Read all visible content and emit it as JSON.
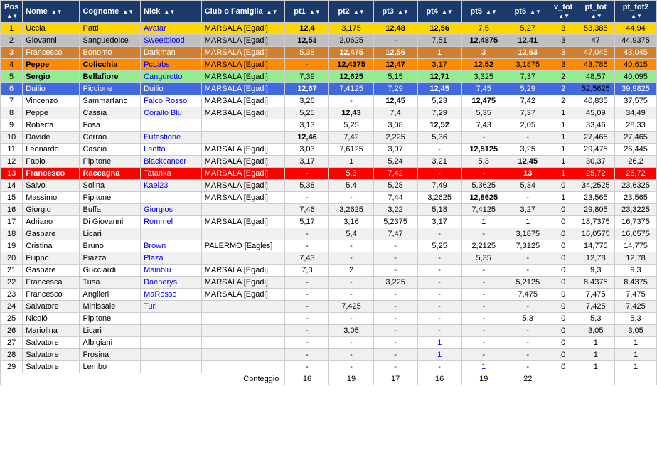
{
  "header": {
    "pos": "Pos",
    "nome": "Nome",
    "cognome": "Cognome",
    "nick": "Nick",
    "club": "Club o Famiglia",
    "pt1": "pt1",
    "pt2": "pt2",
    "pt3": "pt3",
    "pt4": "pt4",
    "pt5": "pt5",
    "pt6": "pt6",
    "v_tot": "v_tot",
    "pt_tot": "pt_tot",
    "pt_tot2": "pt_tot2"
  },
  "rows": [
    {
      "pos": "1",
      "nome": "Uccia",
      "cognome": "Patti",
      "nick": "Avatar",
      "club": "MARSALA [Egadi]",
      "pt1": "12,4",
      "pt2": "3,175",
      "pt3": "12,48",
      "pt4": "12,56",
      "pt5": "7,5",
      "pt6": "5,27",
      "v_tot": "3",
      "pt_tot": "53,385",
      "pt_tot2": "44,94",
      "row_class": "row-gold",
      "nome_class": "",
      "cognome_class": ""
    },
    {
      "pos": "2",
      "nome": "Giovanni",
      "cognome": "Sanguedolce",
      "nick": "Sweetblood",
      "club": "MARSALA [Egadi]",
      "pt1": "12,53",
      "pt2": "2,0625",
      "pt3": "-",
      "pt4": "7,51",
      "pt5": "12,4875",
      "pt6": "12,41",
      "v_tot": "3",
      "pt_tot": "47",
      "pt_tot2": "44,9375",
      "row_class": "row-silver",
      "nome_class": "",
      "cognome_class": ""
    },
    {
      "pos": "3",
      "nome": "Francesco",
      "cognome": "Bonomo",
      "nick": "Darkman",
      "club": "MARSALA [Egadi]",
      "pt1": "5,38",
      "pt2": "12,475",
      "pt3": "12,56",
      "pt4": "1",
      "pt5": "3",
      "pt6": "12,63",
      "v_tot": "3",
      "pt_tot": "47,045",
      "pt_tot2": "43,045",
      "row_class": "row-bronze",
      "nome_class": "",
      "cognome_class": ""
    },
    {
      "pos": "4",
      "nome": "Peppe",
      "cognome": "Colicchia",
      "nick": "PcLabs",
      "club": "MARSALA [Egadi]",
      "pt1": "-",
      "pt2": "12,4375",
      "pt3": "12,47",
      "pt4": "3,17",
      "pt5": "12,52",
      "pt6": "3,1875",
      "v_tot": "3",
      "pt_tot": "43,785",
      "pt_tot2": "40,615",
      "row_class": "row-orange",
      "nome_class": "text-bold",
      "cognome_class": "text-bold"
    },
    {
      "pos": "5",
      "nome": "Sergio",
      "cognome": "Bellafiore",
      "nick": "Cangurotto",
      "club": "MARSALA [Egadi]",
      "pt1": "7,39",
      "pt2": "12,625",
      "pt3": "5,15",
      "pt4": "12,71",
      "pt5": "3,325",
      "pt6": "7,37",
      "v_tot": "2",
      "pt_tot": "48,57",
      "pt_tot2": "40,095",
      "row_class": "row-green",
      "nome_class": "text-bold",
      "cognome_class": "text-bold"
    },
    {
      "pos": "6",
      "nome": "Duilio",
      "cognome": "Piccione",
      "nick": "Duilio",
      "club": "MARSALA [Egadi]",
      "pt1": "12,67",
      "pt2": "7,4125",
      "pt3": "7,29",
      "pt4": "12,45",
      "pt5": "7,45",
      "pt6": "5,29",
      "v_tot": "2",
      "pt_tot": "52,5625",
      "pt_tot2": "39,9825",
      "row_class": "row-blue",
      "nome_class": "",
      "cognome_class": ""
    },
    {
      "pos": "7",
      "nome": "Vincenzo",
      "cognome": "Sammartano",
      "nick": "Falco Rosso",
      "club": "MARSALA [Egadi]",
      "pt1": "3,26",
      "pt2": "-",
      "pt3": "12,45",
      "pt4": "5,23",
      "pt5": "12,475",
      "pt6": "7,42",
      "v_tot": "2",
      "pt_tot": "40,835",
      "pt_tot2": "37,575",
      "row_class": "",
      "nome_class": "",
      "cognome_class": ""
    },
    {
      "pos": "8",
      "nome": "Peppe",
      "cognome": "Cassia",
      "nick": "Corallo Blu",
      "club": "MARSALA [Egadi]",
      "pt1": "5,25",
      "pt2": "12,43",
      "pt3": "7,4",
      "pt4": "7,29",
      "pt5": "5,35",
      "pt6": "7,37",
      "v_tot": "1",
      "pt_tot": "45,09",
      "pt_tot2": "34,49",
      "row_class": "",
      "nome_class": "",
      "cognome_class": ""
    },
    {
      "pos": "9",
      "nome": "Roberta",
      "cognome": "Fosa",
      "nick": "",
      "club": "",
      "pt1": "3,13",
      "pt2": "5,25",
      "pt3": "3,08",
      "pt4": "12,52",
      "pt5": "7,43",
      "pt6": "2,05",
      "v_tot": "1",
      "pt_tot": "33,46",
      "pt_tot2": "28,33",
      "row_class": "",
      "nome_class": "",
      "cognome_class": ""
    },
    {
      "pos": "10",
      "nome": "Davide",
      "cognome": "Corrao",
      "nick": "Eufestione",
      "club": "",
      "pt1": "12,46",
      "pt2": "7,42",
      "pt3": "2,225",
      "pt4": "5,36",
      "pt5": "-",
      "pt6": "-",
      "v_tot": "1",
      "pt_tot": "27,465",
      "pt_tot2": "27,465",
      "row_class": "",
      "nome_class": "",
      "cognome_class": ""
    },
    {
      "pos": "11",
      "nome": "Leonardo",
      "cognome": "Cascio",
      "nick": "Leotto",
      "club": "MARSALA [Egadi]",
      "pt1": "3,03",
      "pt2": "7,6125",
      "pt3": "3,07",
      "pt4": "-",
      "pt5": "12,5125",
      "pt6": "3,25",
      "v_tot": "1",
      "pt_tot": "29,475",
      "pt_tot2": "26,445",
      "row_class": "",
      "nome_class": "",
      "cognome_class": ""
    },
    {
      "pos": "12",
      "nome": "Fabio",
      "cognome": "Pipitone",
      "nick": "Blackcancer",
      "club": "MARSALA [Egadi]",
      "pt1": "3,17",
      "pt2": "1",
      "pt3": "5,24",
      "pt4": "3,21",
      "pt5": "5,3",
      "pt6": "12,45",
      "v_tot": "1",
      "pt_tot": "30,37",
      "pt_tot2": "26,2",
      "row_class": "",
      "nome_class": "",
      "cognome_class": ""
    },
    {
      "pos": "13",
      "nome": "Francesco",
      "cognome": "Raccagna",
      "nick": "Tatanka",
      "club": "MARSALA [Egadi]",
      "pt1": "-",
      "pt2": "5,3",
      "pt3": "7,42",
      "pt4": "-",
      "pt5": "-",
      "pt6": "13",
      "v_tot": "1",
      "pt_tot": "25,72",
      "pt_tot2": "25,72",
      "row_class": "row-red",
      "nome_class": "text-bold",
      "cognome_class": "text-bold"
    },
    {
      "pos": "14",
      "nome": "Salvo",
      "cognome": "Solina",
      "nick": "Kael23",
      "club": "MARSALA [Egadi]",
      "pt1": "5,38",
      "pt2": "5,4",
      "pt3": "5,28",
      "pt4": "7,49",
      "pt5": "5,3625",
      "pt6": "5,34",
      "v_tot": "0",
      "pt_tot": "34,2525",
      "pt_tot2": "23,6325",
      "row_class": "",
      "nome_class": "",
      "cognome_class": ""
    },
    {
      "pos": "15",
      "nome": "Massimo",
      "cognome": "Pipitone",
      "nick": "",
      "club": "MARSALA [Egadi]",
      "pt1": "-",
      "pt2": "-",
      "pt3": "7,44",
      "pt4": "3,2625",
      "pt5": "12,8625",
      "pt6": "-",
      "v_tot": "1",
      "pt_tot": "23,565",
      "pt_tot2": "23,565",
      "row_class": "",
      "nome_class": "",
      "cognome_class": ""
    },
    {
      "pos": "16",
      "nome": "Giorgio",
      "cognome": "Buffa",
      "nick": "Giorgios",
      "club": "",
      "pt1": "7,46",
      "pt2": "3,2625",
      "pt3": "3,22",
      "pt4": "5,18",
      "pt5": "7,4125",
      "pt6": "3,27",
      "v_tot": "0",
      "pt_tot": "29,805",
      "pt_tot2": "23,3225",
      "row_class": "",
      "nome_class": "",
      "cognome_class": ""
    },
    {
      "pos": "17",
      "nome": "Adriano",
      "cognome": "Di Giovanni",
      "nick": "Rommel",
      "club": "MARSALA [Egadi]",
      "pt1": "5,17",
      "pt2": "3,16",
      "pt3": "5,2375",
      "pt4": "3,17",
      "pt5": "1",
      "pt6": "1",
      "v_tot": "0",
      "pt_tot": "18,7375",
      "pt_tot2": "16,7375",
      "row_class": "",
      "nome_class": "",
      "cognome_class": ""
    },
    {
      "pos": "18",
      "nome": "Gaspare",
      "cognome": "Licari",
      "nick": "",
      "club": "",
      "pt1": "-",
      "pt2": "5,4",
      "pt3": "7,47",
      "pt4": "-",
      "pt5": "-",
      "pt6": "3,1875",
      "v_tot": "0",
      "pt_tot": "16,0575",
      "pt_tot2": "16,0575",
      "row_class": "",
      "nome_class": "",
      "cognome_class": ""
    },
    {
      "pos": "19",
      "nome": "Cristina",
      "cognome": "Bruno",
      "nick": "Brown",
      "club": "PALERMO [Eagles]",
      "pt1": "-",
      "pt2": "-",
      "pt3": "-",
      "pt4": "5,25",
      "pt5": "2,2125",
      "pt6": "7,3125",
      "v_tot": "0",
      "pt_tot": "14,775",
      "pt_tot2": "14,775",
      "row_class": "",
      "nome_class": "",
      "cognome_class": ""
    },
    {
      "pos": "20",
      "nome": "Filippo",
      "cognome": "Piazza",
      "nick": "Plaza",
      "club": "",
      "pt1": "7,43",
      "pt2": "-",
      "pt3": "-",
      "pt4": "-",
      "pt5": "5,35",
      "pt6": "-",
      "v_tot": "0",
      "pt_tot": "12,78",
      "pt_tot2": "12,78",
      "row_class": "",
      "nome_class": "",
      "cognome_class": ""
    },
    {
      "pos": "21",
      "nome": "Gaspare",
      "cognome": "Gucciardi",
      "nick": "Mainblu",
      "club": "MARSALA [Egadi]",
      "pt1": "7,3",
      "pt2": "2",
      "pt3": "-",
      "pt4": "-",
      "pt5": "-",
      "pt6": "-",
      "v_tot": "0",
      "pt_tot": "9,3",
      "pt_tot2": "9,3",
      "row_class": "",
      "nome_class": "",
      "cognome_class": ""
    },
    {
      "pos": "22",
      "nome": "Francesca",
      "cognome": "Tusa",
      "nick": "Daenerys",
      "club": "MARSALA [Egadi]",
      "pt1": "-",
      "pt2": "-",
      "pt3": "3,225",
      "pt4": "-",
      "pt5": "-",
      "pt6": "5,2125",
      "v_tot": "0",
      "pt_tot": "8,4375",
      "pt_tot2": "8,4375",
      "row_class": "",
      "nome_class": "",
      "cognome_class": ""
    },
    {
      "pos": "23",
      "nome": "Francesco",
      "cognome": "Angileri",
      "nick": "MaRosso",
      "club": "MARSALA [Egadi]",
      "pt1": "-",
      "pt2": "-",
      "pt3": "-",
      "pt4": "-",
      "pt5": "-",
      "pt6": "7,475",
      "v_tot": "0",
      "pt_tot": "7,475",
      "pt_tot2": "7,475",
      "row_class": "",
      "nome_class": "",
      "cognome_class": ""
    },
    {
      "pos": "24",
      "nome": "Salvatore",
      "cognome": "Minissale",
      "nick": "Turi",
      "club": "",
      "pt1": "-",
      "pt2": "7,425",
      "pt3": "-",
      "pt4": "-",
      "pt5": "-",
      "pt6": "-",
      "v_tot": "0",
      "pt_tot": "7,425",
      "pt_tot2": "7,425",
      "row_class": "",
      "nome_class": "",
      "cognome_class": ""
    },
    {
      "pos": "25",
      "nome": "Nicolò",
      "cognome": "Pipitone",
      "nick": "",
      "club": "",
      "pt1": "-",
      "pt2": "-",
      "pt3": "-",
      "pt4": "-",
      "pt5": "-",
      "pt6": "5,3",
      "v_tot": "0",
      "pt_tot": "5,3",
      "pt_tot2": "5,3",
      "row_class": "",
      "nome_class": "",
      "cognome_class": ""
    },
    {
      "pos": "26",
      "nome": "Mariolina",
      "cognome": "Licari",
      "nick": "",
      "club": "",
      "pt1": "-",
      "pt2": "3,05",
      "pt3": "-",
      "pt4": "-",
      "pt5": "-",
      "pt6": "-",
      "v_tot": "0",
      "pt_tot": "3,05",
      "pt_tot2": "3,05",
      "row_class": "",
      "nome_class": "",
      "cognome_class": ""
    },
    {
      "pos": "27",
      "nome": "Salvatore",
      "cognome": "Albigiani",
      "nick": "",
      "club": "",
      "pt1": "-",
      "pt2": "-",
      "pt3": "-",
      "pt4": "1",
      "pt5": "-",
      "pt6": "-",
      "v_tot": "0",
      "pt_tot": "1",
      "pt_tot2": "1",
      "row_class": "",
      "nome_class": "",
      "cognome_class": "",
      "pt4_class": "text-blue"
    },
    {
      "pos": "28",
      "nome": "Salvatore",
      "cognome": "Frosina",
      "nick": "",
      "club": "",
      "pt1": "-",
      "pt2": "-",
      "pt3": "-",
      "pt4": "1",
      "pt5": "-",
      "pt6": "-",
      "v_tot": "0",
      "pt_tot": "1",
      "pt_tot2": "1",
      "row_class": "",
      "nome_class": "",
      "cognome_class": "",
      "pt4_class": "text-blue"
    },
    {
      "pos": "29",
      "nome": "Salvatore",
      "cognome": "Lembo",
      "nick": "",
      "club": "",
      "pt1": "-",
      "pt2": "-",
      "pt3": "-",
      "pt4": "-",
      "pt5": "1",
      "pt6": "-",
      "v_tot": "0",
      "pt_tot": "1",
      "pt_tot2": "1",
      "row_class": "",
      "nome_class": "",
      "cognome_class": "",
      "pt5_class": "text-blue"
    }
  ],
  "footer": {
    "label": "Conteggio",
    "pt1": "16",
    "pt2": "19",
    "pt3": "17",
    "pt4": "16",
    "pt5": "19",
    "pt6": "22"
  }
}
